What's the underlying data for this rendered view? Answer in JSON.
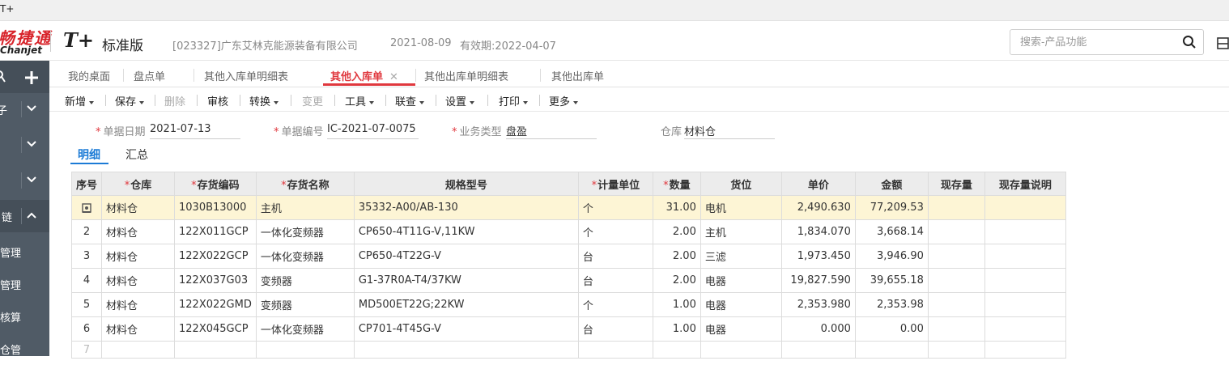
{
  "window": {
    "title_fragment": "T+"
  },
  "header": {
    "logo_cn": "畅捷通",
    "logo_en": "Chanjet",
    "edition_mark": "T+",
    "edition_name": "标准版",
    "company": "[023327]广东艾林克能源装备有限公司",
    "date": "2021-08-09",
    "validity": "有效期:2022-04-07",
    "search_placeholder": "搜索-产品功能"
  },
  "sidebar": {
    "items": [
      {
        "label": "",
        "expanded": false
      },
      {
        "label": "",
        "expanded": false
      },
      {
        "label": "",
        "expanded": false
      },
      {
        "label": "链",
        "expanded": true
      },
      {
        "label": "管理"
      },
      {
        "label": "管理"
      },
      {
        "label": "核算"
      },
      {
        "label": "仓管"
      }
    ],
    "item1_label": "子"
  },
  "tabs": [
    {
      "label": "我的桌面"
    },
    {
      "label": "盘点单"
    },
    {
      "label": "其他入库单明细表"
    },
    {
      "label": "其他入库单",
      "active": true
    },
    {
      "label": "其他出库单明细表"
    },
    {
      "label": "其他出库单"
    }
  ],
  "toolbar": {
    "new": "新增",
    "save": "保存",
    "delete": "删除",
    "audit": "审核",
    "convert": "转换",
    "change": "变更",
    "tools": "工具",
    "query": "联查",
    "settings": "设置",
    "print": "打印",
    "more": "更多"
  },
  "form": {
    "doc_date_label": "单据日期",
    "doc_date": "2021-07-13",
    "doc_no_label": "单据编号",
    "doc_no": "IC-2021-07-0075",
    "biz_type_label": "业务类型",
    "biz_type": "盘盈",
    "warehouse_label": "仓库",
    "warehouse": "材料仓"
  },
  "subtabs": {
    "detail": "明细",
    "summary": "汇总"
  },
  "grid": {
    "columns": [
      "序号",
      "仓库",
      "存货编码",
      "存货名称",
      "规格型号",
      "计量单位",
      "数量",
      "货位",
      "单价",
      "金额",
      "现存量",
      "现存量说明"
    ],
    "rows": [
      {
        "no": "",
        "wh": "材料仓",
        "code": "1030B13000",
        "name": "主机",
        "spec": "35332-A00/AB-130",
        "unit": "个",
        "qty": "31.00",
        "loc": "电机",
        "price": "2,490.630",
        "amount": "77,209.53",
        "stock": "",
        "stock_note": ""
      },
      {
        "no": "2",
        "wh": "材料仓",
        "code": "122X011GCP",
        "name": "一体化变频器",
        "spec": "CP650-4T11G-V,11KW",
        "unit": "个",
        "qty": "2.00",
        "loc": "主机",
        "price": "1,834.070",
        "amount": "3,668.14",
        "stock": "",
        "stock_note": ""
      },
      {
        "no": "3",
        "wh": "材料仓",
        "code": "122X022GCP",
        "name": "一体化变频器",
        "spec": "CP650-4T22G-V",
        "unit": "台",
        "qty": "2.00",
        "loc": "三滤",
        "price": "1,973.450",
        "amount": "3,946.90",
        "stock": "",
        "stock_note": ""
      },
      {
        "no": "4",
        "wh": "材料仓",
        "code": "122X037G03",
        "name": "变频器",
        "spec": "G1-37R0A-T4/37KW",
        "unit": "台",
        "qty": "2.00",
        "loc": "电器",
        "price": "19,827.590",
        "amount": "39,655.18",
        "stock": "",
        "stock_note": ""
      },
      {
        "no": "5",
        "wh": "材料仓",
        "code": "122X022GMD",
        "name": "变频器",
        "spec": "MD500ET22G;22KW",
        "unit": "个",
        "qty": "1.00",
        "loc": "电器",
        "price": "2,353.980",
        "amount": "2,353.98",
        "stock": "",
        "stock_note": ""
      },
      {
        "no": "6",
        "wh": "材料仓",
        "code": "122X045GCP",
        "name": "一体化变频器",
        "spec": "CP701-4T45G-V",
        "unit": "台",
        "qty": "1.00",
        "loc": "电器",
        "price": "0.000",
        "amount": "0.00",
        "stock": "",
        "stock_note": ""
      },
      {
        "no": "7",
        "wh": "",
        "code": "",
        "name": "",
        "spec": "",
        "unit": "",
        "qty": "",
        "loc": "",
        "price": "",
        "amount": "",
        "stock": "",
        "stock_note": ""
      }
    ]
  },
  "colors": {
    "accent_red": "#e0383e",
    "accent_blue": "#1c7bd6",
    "sidebar": "#505b66",
    "selected_row": "#fdf5d5"
  }
}
